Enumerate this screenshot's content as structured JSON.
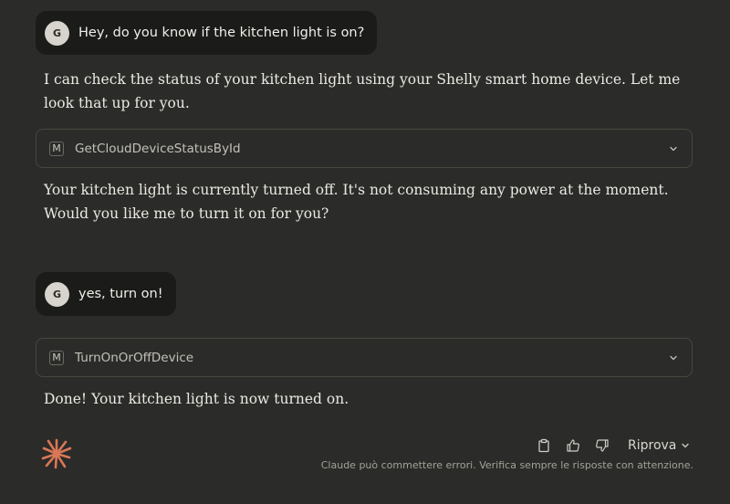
{
  "conversation": {
    "user_initial": "G",
    "messages": [
      {
        "role": "user",
        "text": "Hey, do you know if the kitchen light is on?"
      },
      {
        "role": "assistant",
        "text": "I can check the status of your kitchen light using your Shelly smart home device. Let me look that up for you."
      },
      {
        "role": "tool",
        "icon_letter": "M",
        "name": "GetCloudDeviceStatusById",
        "icon": "chevron-down-icon"
      },
      {
        "role": "assistant",
        "text": "Your kitchen light is currently turned off. It's not consuming any power at the moment. Would you like me to turn it on for you?"
      },
      {
        "role": "user",
        "text": "yes, turn on!"
      },
      {
        "role": "tool",
        "icon_letter": "M",
        "name": "TurnOnOrOffDevice",
        "icon": "chevron-down-icon"
      },
      {
        "role": "assistant",
        "text": "Done! Your kitchen light is now turned on."
      }
    ]
  },
  "footer": {
    "logo_icon": "claude-sparkle-icon",
    "logo_color": "#d97757",
    "action_icons": [
      "copy-icon",
      "thumbs-up-icon",
      "thumbs-down-icon"
    ],
    "retry_label": "Riprova",
    "disclaimer": "Claude può commettere errori. Verifica sempre le risposte con attenzione."
  },
  "colors": {
    "background": "#2b2b29",
    "user_bubble": "#1b1b1a",
    "text": "#ebe9e2"
  }
}
